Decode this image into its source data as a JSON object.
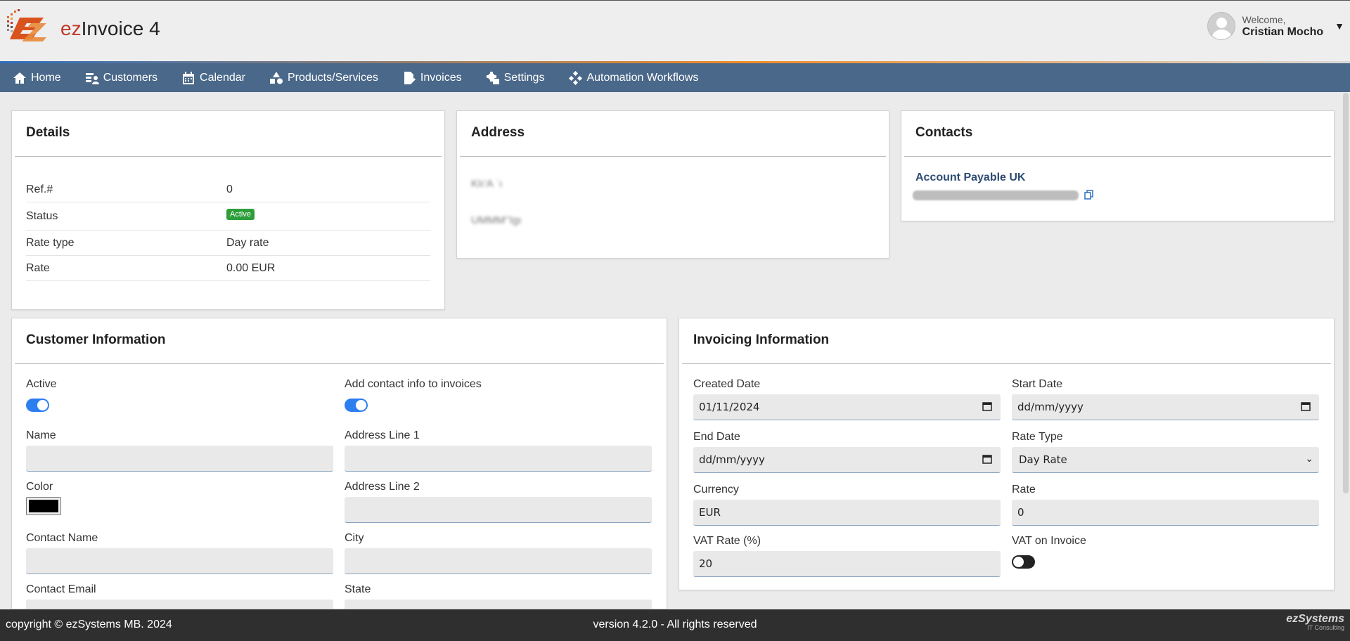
{
  "header": {
    "brand_prefix": "ez",
    "brand_name": "Invoice 4",
    "welcome": "Welcome,",
    "user_name": "Cristian Mocho"
  },
  "nav": [
    {
      "label": "Home",
      "icon": "home-icon"
    },
    {
      "label": "Customers",
      "icon": "customers-icon"
    },
    {
      "label": "Calendar",
      "icon": "calendar-icon"
    },
    {
      "label": "Products/Services",
      "icon": "products-icon"
    },
    {
      "label": "Invoices",
      "icon": "invoice-icon"
    },
    {
      "label": "Settings",
      "icon": "settings-icon"
    },
    {
      "label": "Automation Workflows",
      "icon": "workflow-icon"
    }
  ],
  "details": {
    "title": "Details",
    "rows": [
      {
        "key": "Ref.#",
        "value": "0"
      },
      {
        "key": "Status",
        "value": "Active"
      },
      {
        "key": "Rate type",
        "value": "Day rate"
      },
      {
        "key": "Rate",
        "value": "0.00 EUR"
      }
    ]
  },
  "address": {
    "title": "Address",
    "line1": "KIı’A  ˈı",
    "line2": "UMMM’’Igı"
  },
  "contacts": {
    "title": "Contacts",
    "name": "Account Payable UK"
  },
  "customer_info": {
    "title": "Customer Information",
    "active_label": "Active",
    "add_contact_label": "Add contact info to invoices",
    "name_label": "Name",
    "address1_label": "Address Line 1",
    "color_label": "Color",
    "color_value": "#000000",
    "address2_label": "Address Line 2",
    "contact_name_label": "Contact Name",
    "city_label": "City",
    "contact_email_label": "Contact Email",
    "state_label": "State",
    "active": true,
    "add_contact": true
  },
  "invoicing_info": {
    "title": "Invoicing Information",
    "created_label": "Created Date",
    "created_value": "01/11/2024",
    "start_label": "Start Date",
    "start_value": "dd/mm/yyyy",
    "end_label": "End Date",
    "end_value": "dd/mm/yyyy",
    "rate_type_label": "Rate Type",
    "rate_type_value": "Day Rate",
    "currency_label": "Currency",
    "currency_value": "EUR",
    "rate_label": "Rate",
    "rate_value": "0",
    "vat_rate_label": "VAT Rate (%)",
    "vat_rate_value": "20",
    "vat_on_invoice_label": "VAT on Invoice",
    "vat_on_invoice": false
  },
  "footer": {
    "copyright": "copyright © ezSystems MB. 2024",
    "version": "version 4.2.0 - All rights reserved",
    "logo_name": "ezSystems",
    "logo_tagline": "IT Consulting"
  }
}
